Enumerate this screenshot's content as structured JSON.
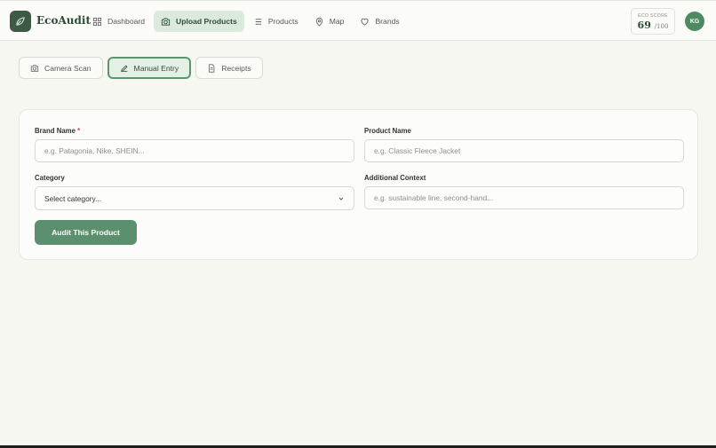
{
  "app": {
    "name": "EcoAudit",
    "logo_icon": "leaf-icon",
    "accent": "#5b8f6d"
  },
  "nav": [
    {
      "label": "Dashboard",
      "icon": "grid-icon",
      "active": false
    },
    {
      "label": "Upload Products",
      "icon": "camera-icon",
      "active": true
    },
    {
      "label": "Products",
      "icon": "list-icon",
      "active": false
    },
    {
      "label": "Map",
      "icon": "map-pin-icon",
      "active": false
    },
    {
      "label": "Brands",
      "icon": "heart-icon",
      "active": false
    }
  ],
  "eco_score": {
    "label": "ECO SCORE",
    "value": "69",
    "max": "/100"
  },
  "user": {
    "initials": "KG"
  },
  "tabs": [
    {
      "label": "Camera Scan",
      "icon": "camera-icon",
      "active": false
    },
    {
      "label": "Manual Entry",
      "icon": "pencil-icon",
      "active": true
    },
    {
      "label": "Receipts",
      "icon": "document-icon",
      "active": false
    }
  ],
  "form": {
    "brand_label": "Brand Name",
    "brand_required": "*",
    "brand_placeholder": "e.g. Patagonia, Nike, SHEIN...",
    "product_label": "Product Name",
    "product_placeholder": "e.g. Classic Fleece Jacket",
    "category_label": "Category",
    "category_value": "Select category...",
    "context_label": "Additional Context",
    "context_placeholder": "e.g. sustainable line, second-hand...",
    "submit_label": "Audit This Product"
  }
}
